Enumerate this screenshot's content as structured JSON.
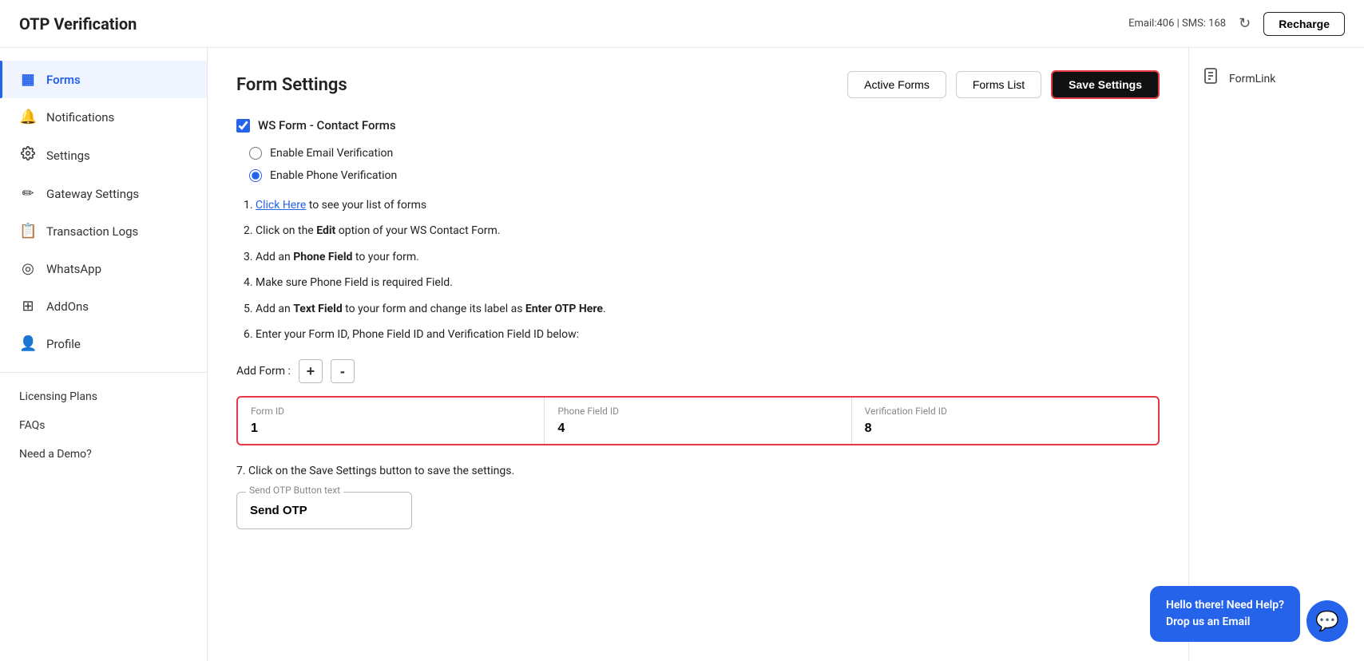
{
  "header": {
    "title": "OTP Verification",
    "credits": "Email:406 | SMS: 168",
    "recharge_label": "Recharge",
    "refresh_icon": "↻"
  },
  "sidebar": {
    "items": [
      {
        "id": "forms",
        "label": "Forms",
        "icon": "▦",
        "active": true
      },
      {
        "id": "notifications",
        "label": "Notifications",
        "icon": "🔔"
      },
      {
        "id": "settings",
        "label": "Settings",
        "icon": "⚙"
      },
      {
        "id": "gateway-settings",
        "label": "Gateway Settings",
        "icon": "✏"
      },
      {
        "id": "transaction-logs",
        "label": "Transaction Logs",
        "icon": "📋"
      },
      {
        "id": "whatsapp",
        "label": "WhatsApp",
        "icon": "◎"
      },
      {
        "id": "addons",
        "label": "AddOns",
        "icon": "⊞"
      },
      {
        "id": "profile",
        "label": "Profile",
        "icon": "👤"
      }
    ],
    "plain_items": [
      {
        "id": "licensing-plans",
        "label": "Licensing Plans"
      },
      {
        "id": "faqs",
        "label": "FAQs"
      },
      {
        "id": "need-a-demo",
        "label": "Need a Demo?"
      }
    ]
  },
  "main": {
    "page_title": "Form Settings",
    "active_forms_label": "Active Forms",
    "forms_list_label": "Forms List",
    "save_settings_label": "Save Settings",
    "form_checkbox_label": "WS Form - Contact Forms",
    "enable_email_label": "Enable Email Verification",
    "enable_phone_label": "Enable Phone Verification",
    "instructions": [
      {
        "text_before": "",
        "link": "Click Here",
        "text_after": " to see your list of forms"
      },
      {
        "text_before": "Click on the ",
        "bold": "Edit",
        "text_after": " option of your WS Contact Form."
      },
      {
        "text_before": "Add an ",
        "bold": "Phone Field",
        "text_after": " to your form."
      },
      {
        "text_before": "Make sure Phone Field is required Field.",
        "bold": "",
        "text_after": ""
      },
      {
        "text_before": "Add an ",
        "bold": "Text Field",
        "text_after": " to your form and change its label as ",
        "bold2": "Enter OTP Here",
        "text_after2": "."
      },
      {
        "text_before": "Enter your Form ID, Phone Field ID and Verification Field ID below:",
        "bold": "",
        "text_after": ""
      }
    ],
    "add_form_label": "Add Form :",
    "plus_label": "+",
    "minus_label": "-",
    "field_table": {
      "col1_label": "Form ID",
      "col1_value": "1",
      "col2_label": "Phone Field ID",
      "col2_value": "4",
      "col3_label": "Verification Field ID",
      "col3_value": "8"
    },
    "step7_text": "7. Click on the Save Settings button to save the settings.",
    "send_otp_field_label": "Send OTP Button text",
    "send_otp_value": "Send OTP"
  },
  "right_panel": {
    "form_link_label": "FormLink",
    "form_link_icon": "📄"
  },
  "help": {
    "text_line1": "Hello there! Need Help?",
    "text_line2": "Drop us an Email",
    "chat_icon": "💬"
  }
}
